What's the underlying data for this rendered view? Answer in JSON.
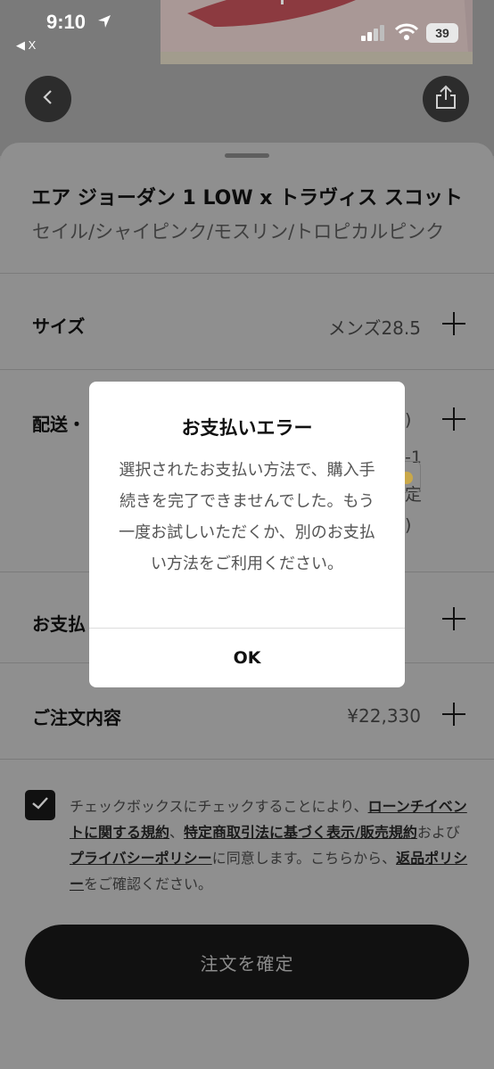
{
  "status_bar": {
    "time": "9:10",
    "back_app": "◀ X",
    "battery": "39"
  },
  "product": {
    "name": "エア ジョーダン 1 LOW x トラヴィス スコット",
    "colorway": "セイル/シャイピンク/モスリン/トロピカルピンク"
  },
  "rows": {
    "size": {
      "label": "サイズ",
      "value": "メンズ28.5"
    },
    "shipping": {
      "label": "配送・",
      "frag_1": ")",
      "frag_2": "-1",
      "frag_3": "定",
      "frag_4": ")"
    },
    "payment": {
      "label": "お支払"
    },
    "order": {
      "label": "ご注文内容",
      "value": "¥22,330"
    }
  },
  "terms": {
    "t1": "チェックボックスにチェックすることにより、",
    "link1": "ローンチイベントに関する規約",
    "t2": "、",
    "link2": "特定商取引法に基づく表示/販売規約",
    "t3": "および",
    "link3": "プライバシーポリシー",
    "t4": "に同意します。こちらから、",
    "link4": "返品ポリシー",
    "t5": "をご確認ください。"
  },
  "confirm_button": "注文を確定",
  "alert": {
    "title": "お支払いエラー",
    "message": "選択されたお支払い方法で、購入手続きを完了できませんでした。もう一度お試しいただくか、別のお支払い方法をご利用ください。",
    "ok": "OK"
  },
  "colors": {
    "overlay_dim": "#8f8f8f",
    "button": "#111111",
    "shoe_swoosh": "#c9424f",
    "shoe_body": "#d9c7c5"
  }
}
